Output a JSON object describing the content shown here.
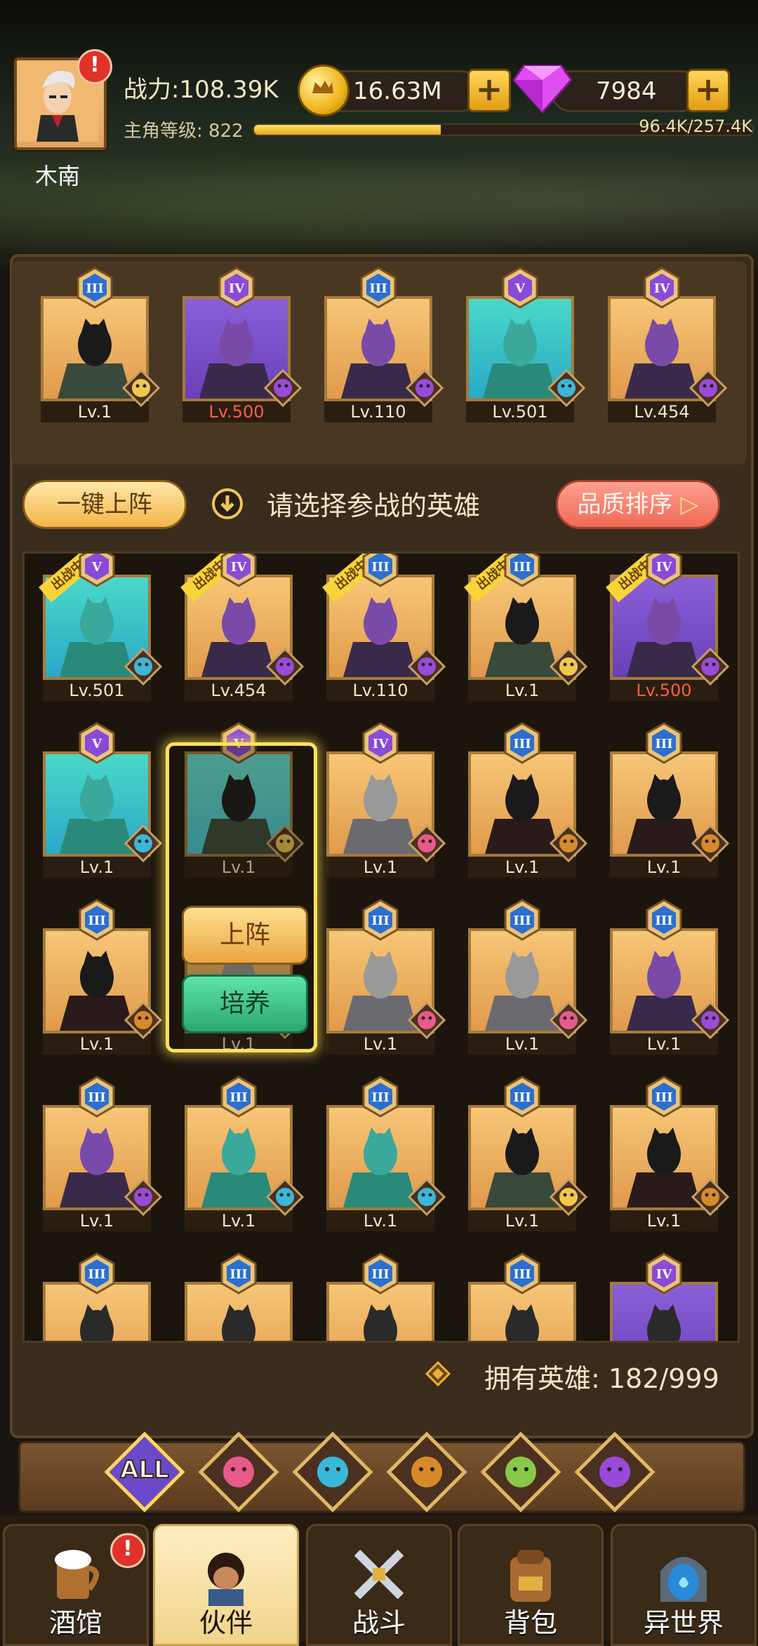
{
  "player": {
    "name": "木南",
    "power": "战力:108.39K",
    "level_label": "主角等级: 822",
    "xp_text": "96.4K/257.4K",
    "xp_fraction": 0.375
  },
  "currency": {
    "gold": "16.63M",
    "gems": "7984"
  },
  "team": [
    {
      "rank": "III",
      "level": "Lv.1",
      "color": "gold",
      "faction": "elf"
    },
    {
      "rank": "IV",
      "level": "Lv.500",
      "color": "purple",
      "faction": "demon",
      "level_red": true
    },
    {
      "rank": "III",
      "level": "Lv.110",
      "color": "gold",
      "faction": "demon"
    },
    {
      "rank": "V",
      "level": "Lv.501",
      "color": "teal",
      "faction": "sea"
    },
    {
      "rank": "IV",
      "level": "Lv.454",
      "color": "gold",
      "faction": "demon"
    }
  ],
  "actions": {
    "one_key": "一键上阵",
    "hint": "请选择参战的英雄",
    "sort": "品质排序"
  },
  "fighting_badge": "出战中",
  "grid": [
    {
      "rank": "V",
      "level": "Lv.501",
      "color": "teal",
      "faction": "sea",
      "fighting": true
    },
    {
      "rank": "IV",
      "level": "Lv.454",
      "color": "gold",
      "faction": "demon",
      "fighting": true
    },
    {
      "rank": "III",
      "level": "Lv.110",
      "color": "gold",
      "faction": "demon",
      "fighting": true
    },
    {
      "rank": "III",
      "level": "Lv.1",
      "color": "gold",
      "faction": "elf",
      "fighting": true
    },
    {
      "rank": "IV",
      "level": "Lv.500",
      "color": "purple",
      "faction": "demon",
      "fighting": true,
      "level_red": true
    },
    {
      "rank": "V",
      "level": "Lv.1",
      "color": "teal",
      "faction": "sea"
    },
    {
      "rank": "V",
      "level": "Lv.1",
      "color": "cyan",
      "faction": "elf"
    },
    {
      "rank": "IV",
      "level": "Lv.1",
      "color": "gold",
      "faction": "human"
    },
    {
      "rank": "III",
      "level": "Lv.1",
      "color": "gold",
      "faction": "beast"
    },
    {
      "rank": "III",
      "level": "Lv.1",
      "color": "gold",
      "faction": "beast"
    },
    {
      "rank": "III",
      "level": "Lv.1",
      "color": "gold",
      "faction": "beast"
    },
    {
      "rank": "",
      "level": "Lv.1",
      "color": "gold",
      "faction": "human"
    },
    {
      "rank": "III",
      "level": "Lv.1",
      "color": "gold",
      "faction": "human"
    },
    {
      "rank": "III",
      "level": "Lv.1",
      "color": "gold",
      "faction": "human"
    },
    {
      "rank": "III",
      "level": "Lv.1",
      "color": "gold",
      "faction": "demon"
    },
    {
      "rank": "III",
      "level": "Lv.1",
      "color": "gold",
      "faction": "demon"
    },
    {
      "rank": "III",
      "level": "Lv.1",
      "color": "gold",
      "faction": "sea"
    },
    {
      "rank": "III",
      "level": "Lv.1",
      "color": "gold",
      "faction": "sea"
    },
    {
      "rank": "III",
      "level": "Lv.1",
      "color": "gold",
      "faction": "elf"
    },
    {
      "rank": "III",
      "level": "Lv.1",
      "color": "gold",
      "faction": "beast"
    },
    {
      "rank": "III",
      "level": "",
      "color": "gold",
      "faction": ""
    },
    {
      "rank": "III",
      "level": "",
      "color": "gold",
      "faction": ""
    },
    {
      "rank": "III",
      "level": "",
      "color": "gold",
      "faction": ""
    },
    {
      "rank": "III",
      "level": "",
      "color": "gold",
      "faction": ""
    },
    {
      "rank": "IV",
      "level": "",
      "color": "purple",
      "faction": ""
    }
  ],
  "popup": {
    "deploy": "上阵",
    "train": "培养"
  },
  "owned": "拥有英雄: 182/999",
  "filters": [
    {
      "label": "ALL",
      "icon": "all-filter-icon"
    },
    {
      "label": "",
      "icon": "human-faction-icon"
    },
    {
      "label": "",
      "icon": "sea-faction-icon"
    },
    {
      "label": "",
      "icon": "beast-faction-icon"
    },
    {
      "label": "",
      "icon": "elf-faction-icon"
    },
    {
      "label": "",
      "icon": "demon-faction-icon"
    }
  ],
  "nav": [
    {
      "label": "酒馆",
      "icon": "tavern-icon",
      "alert": true
    },
    {
      "label": "伙伴",
      "icon": "partner-icon",
      "active": true
    },
    {
      "label": "战斗",
      "icon": "battle-icon"
    },
    {
      "label": "背包",
      "icon": "backpack-icon"
    },
    {
      "label": "异世界",
      "icon": "portal-icon"
    }
  ],
  "colors": {
    "gold_frame": "#f2b35f",
    "purple_frame": "#7a4fd0",
    "teal_frame": "#3bc8c2",
    "accent": "#ffd659",
    "gem": "#d03ae8"
  }
}
